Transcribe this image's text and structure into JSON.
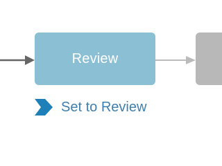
{
  "workflow": {
    "current_step": {
      "label": "Review",
      "color": "#8bbfd4"
    },
    "next_step": {
      "label": "",
      "color": "#b8b8b8"
    },
    "connector_color_in": "#666666",
    "connector_color_out": "#bbbbbb",
    "action": {
      "icon": "chevron-right-icon",
      "icon_color": "#1f7fb8",
      "label": "Set to Review",
      "color": "#3e7fb0"
    }
  }
}
